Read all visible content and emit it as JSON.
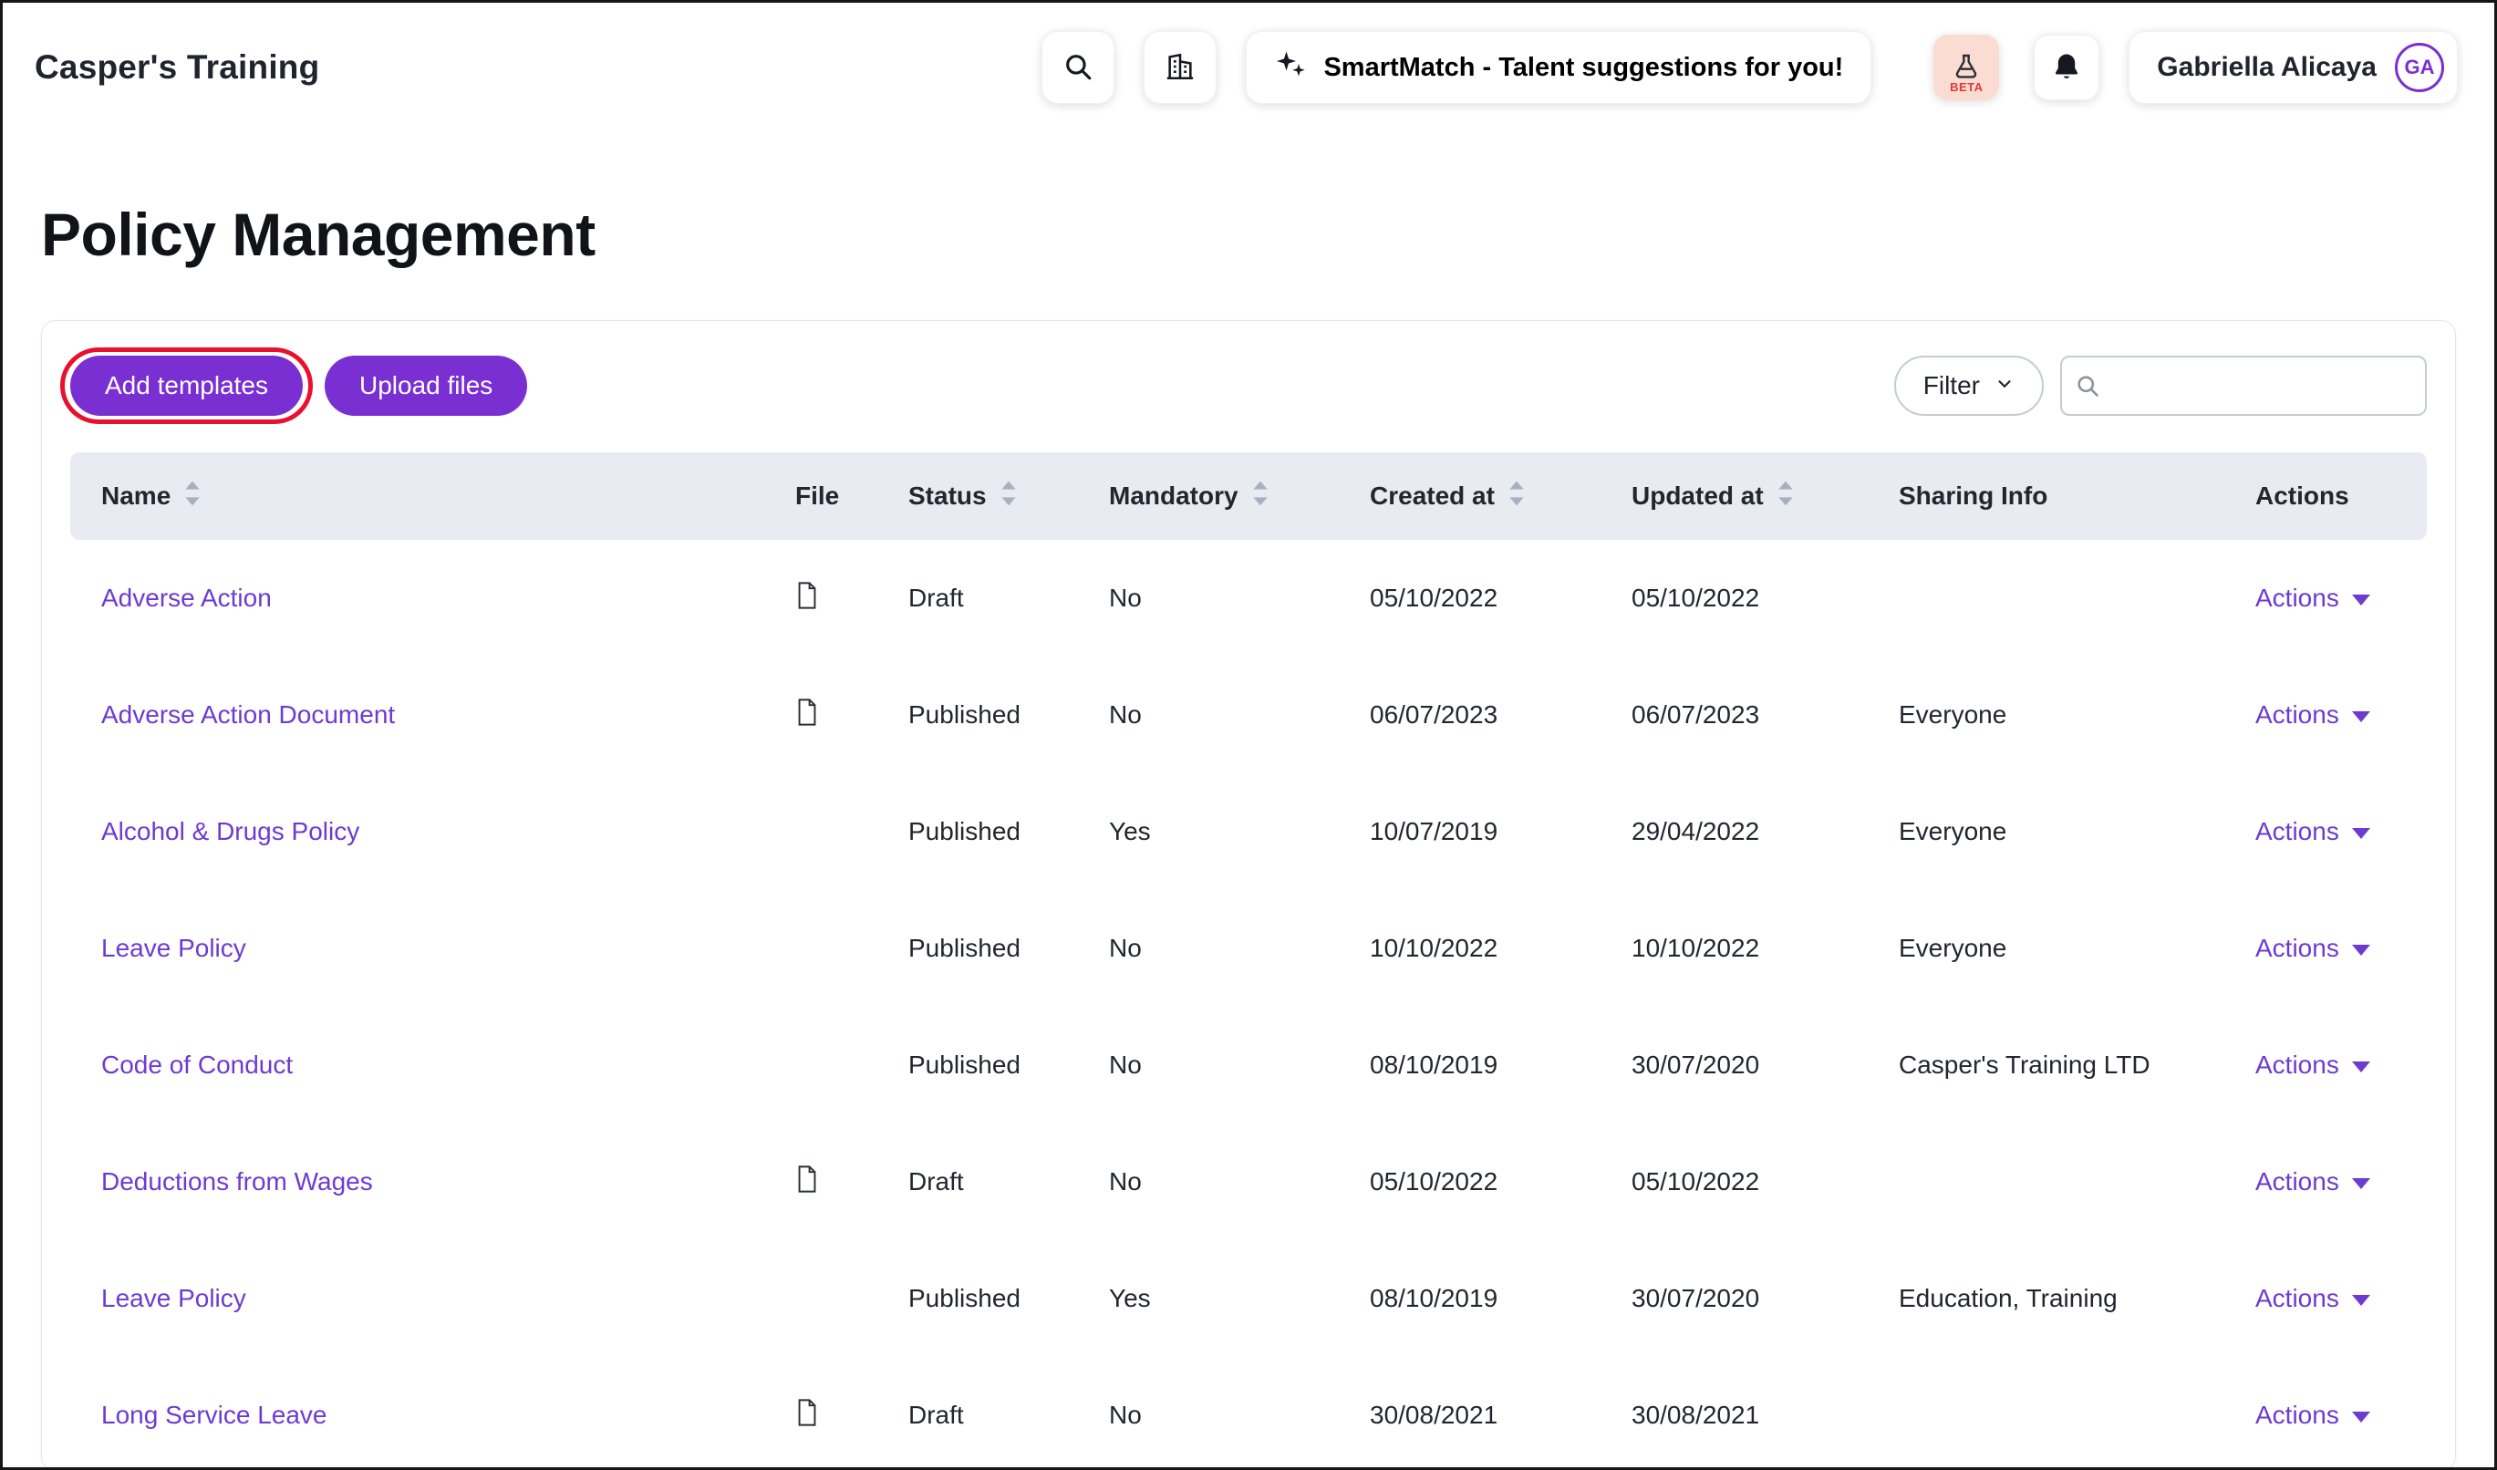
{
  "header": {
    "app_title": "Casper's Training",
    "smartmatch_label": "SmartMatch - Talent suggestions for you!",
    "beta_badge": "BETA",
    "user": {
      "name": "Gabriella Alicaya",
      "initials": "GA"
    }
  },
  "page": {
    "title": "Policy Management"
  },
  "toolbar": {
    "add_templates": "Add templates",
    "upload_files": "Upload files",
    "filter": "Filter",
    "search_value": ""
  },
  "table": {
    "columns": [
      {
        "label": "Name",
        "sortable": true
      },
      {
        "label": "File",
        "sortable": false
      },
      {
        "label": "Status",
        "sortable": true
      },
      {
        "label": "Mandatory",
        "sortable": true
      },
      {
        "label": "Created at",
        "sortable": true
      },
      {
        "label": "Updated at",
        "sortable": true
      },
      {
        "label": "Sharing Info",
        "sortable": false
      },
      {
        "label": "Actions",
        "sortable": false
      }
    ],
    "actions_label": "Actions",
    "rows": [
      {
        "name": "Adverse Action",
        "file": true,
        "status": "Draft",
        "mandatory": "No",
        "created_at": "05/10/2022",
        "updated_at": "05/10/2022",
        "sharing_info": ""
      },
      {
        "name": "Adverse Action Document",
        "file": true,
        "status": "Published",
        "mandatory": "No",
        "created_at": "06/07/2023",
        "updated_at": "06/07/2023",
        "sharing_info": "Everyone"
      },
      {
        "name": "Alcohol & Drugs Policy",
        "file": false,
        "status": "Published",
        "mandatory": "Yes",
        "created_at": "10/07/2019",
        "updated_at": "29/04/2022",
        "sharing_info": "Everyone"
      },
      {
        "name": "Leave Policy",
        "file": false,
        "status": "Published",
        "mandatory": "No",
        "created_at": "10/10/2022",
        "updated_at": "10/10/2022",
        "sharing_info": "Everyone"
      },
      {
        "name": "Code of Conduct",
        "file": false,
        "status": "Published",
        "mandatory": "No",
        "created_at": "08/10/2019",
        "updated_at": "30/07/2020",
        "sharing_info": "Casper's Training LTD"
      },
      {
        "name": "Deductions from Wages",
        "file": true,
        "status": "Draft",
        "mandatory": "No",
        "created_at": "05/10/2022",
        "updated_at": "05/10/2022",
        "sharing_info": ""
      },
      {
        "name": "Leave Policy",
        "file": false,
        "status": "Published",
        "mandatory": "Yes",
        "created_at": "08/10/2019",
        "updated_at": "30/07/2020",
        "sharing_info": "Education, Training"
      },
      {
        "name": "Long Service Leave",
        "file": true,
        "status": "Draft",
        "mandatory": "No",
        "created_at": "30/08/2021",
        "updated_at": "30/08/2021",
        "sharing_info": ""
      }
    ]
  },
  "colors": {
    "brand_purple": "#7A2FD2",
    "link_purple": "#6E3BD1",
    "annotation_red": "#E8102E",
    "header_band": "#E9EBF2",
    "beta_pink_bg": "#FBDCD2",
    "beta_red": "#E03A2F",
    "text_dark": "#20242E"
  }
}
